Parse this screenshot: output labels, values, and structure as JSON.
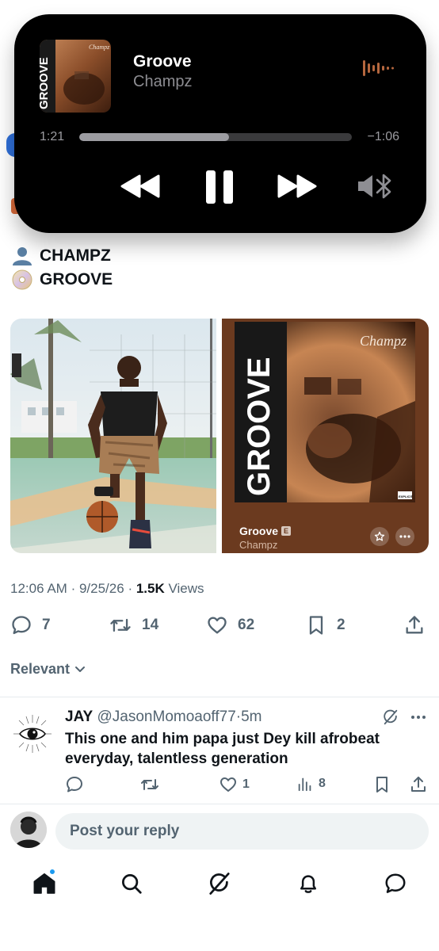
{
  "player": {
    "album_stamp": "GROOVE",
    "album_signature": "Champz",
    "title": "Groove",
    "artist": "Champz",
    "elapsed": "1:21",
    "remaining": "−1:06",
    "progress": 0.55,
    "icons": [
      "waveform-icon",
      "rewind-icon",
      "pause-icon",
      "fast-forward-icon",
      "speaker-icon",
      "bluetooth-icon"
    ]
  },
  "post": {
    "artist_line": "CHAMPZ",
    "track_line": "GROOVE",
    "music_card": {
      "title": "Groove",
      "explicit_badge": "E",
      "artist": "Champz",
      "cover_stamp": "GROOVE",
      "cover_signature": "Champz",
      "parental_badge": "EXPLICIT"
    },
    "time": "12:06 AM",
    "date": "9/25/26",
    "views": "1.5K",
    "views_label": "Views",
    "separator": "·",
    "actions": {
      "replies": "7",
      "reposts": "14",
      "likes": "62",
      "bookmarks": "2"
    },
    "sort_label": "Relevant"
  },
  "reply": {
    "name": "JAY",
    "handle": "@JasonMomoaoff77",
    "time": "5m",
    "text": "This one and him papa just Dey kill afrobeat everyday, talentless generation",
    "likes": "1",
    "views": "8"
  },
  "compose": {
    "placeholder": "Post your reply"
  },
  "colors": {
    "accent": "#1d9bf0",
    "secondary_text": "#536471",
    "card_brown": "#6b3a1f"
  }
}
